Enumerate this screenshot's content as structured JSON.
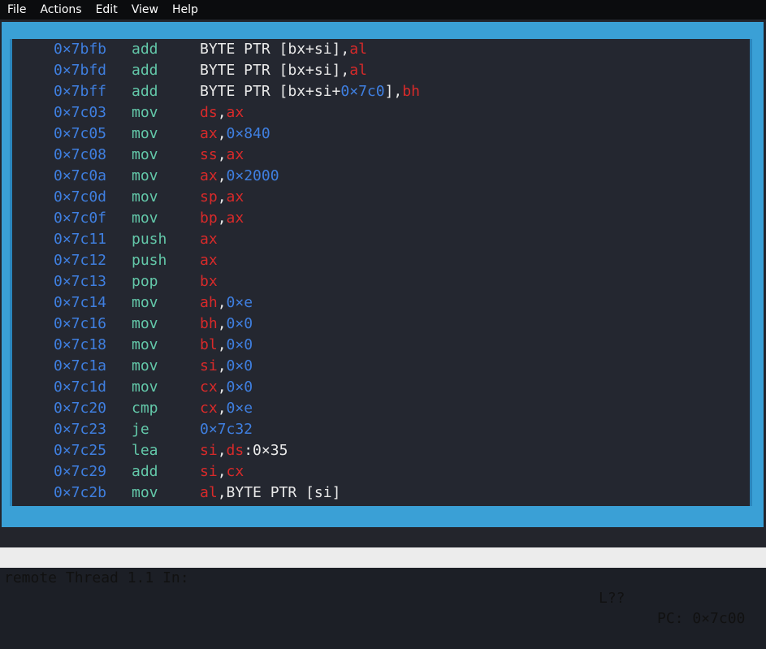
{
  "menu": [
    "File",
    "Actions",
    "Edit",
    "View",
    "Help"
  ],
  "colors": {
    "frame": "#3aa0d6",
    "address": "#3f7fe0",
    "mnemonic": "#63c8a9",
    "register": "#d82a2a",
    "text": "#e9e9e9",
    "status_bg": "#ececec"
  },
  "disassembly": [
    {
      "addr": "0×7bfb",
      "mnem": "add",
      "ops": [
        [
          "t",
          "BYTE PTR [bx+si],"
        ],
        [
          "r",
          "al"
        ]
      ]
    },
    {
      "addr": "0×7bfd",
      "mnem": "add",
      "ops": [
        [
          "t",
          "BYTE PTR [bx+si],"
        ],
        [
          "r",
          "al"
        ]
      ]
    },
    {
      "addr": "0×7bff",
      "mnem": "add",
      "ops": [
        [
          "t",
          "BYTE PTR [bx+si+"
        ],
        [
          "n",
          "0×7c0"
        ],
        [
          "t",
          "],"
        ],
        [
          "r",
          "bh"
        ]
      ]
    },
    {
      "addr": "0×7c03",
      "mnem": "mov",
      "ops": [
        [
          "r",
          "ds"
        ],
        [
          "t",
          ","
        ],
        [
          "r",
          "ax"
        ]
      ]
    },
    {
      "addr": "0×7c05",
      "mnem": "mov",
      "ops": [
        [
          "r",
          "ax"
        ],
        [
          "t",
          ","
        ],
        [
          "n",
          "0×840"
        ]
      ]
    },
    {
      "addr": "0×7c08",
      "mnem": "mov",
      "ops": [
        [
          "r",
          "ss"
        ],
        [
          "t",
          ","
        ],
        [
          "r",
          "ax"
        ]
      ]
    },
    {
      "addr": "0×7c0a",
      "mnem": "mov",
      "ops": [
        [
          "r",
          "ax"
        ],
        [
          "t",
          ","
        ],
        [
          "n",
          "0×2000"
        ]
      ]
    },
    {
      "addr": "0×7c0d",
      "mnem": "mov",
      "ops": [
        [
          "r",
          "sp"
        ],
        [
          "t",
          ","
        ],
        [
          "r",
          "ax"
        ]
      ]
    },
    {
      "addr": "0×7c0f",
      "mnem": "mov",
      "ops": [
        [
          "r",
          "bp"
        ],
        [
          "t",
          ","
        ],
        [
          "r",
          "ax"
        ]
      ]
    },
    {
      "addr": "0×7c11",
      "mnem": "push",
      "ops": [
        [
          "r",
          "ax"
        ]
      ]
    },
    {
      "addr": "0×7c12",
      "mnem": "push",
      "ops": [
        [
          "r",
          "ax"
        ]
      ]
    },
    {
      "addr": "0×7c13",
      "mnem": "pop",
      "ops": [
        [
          "r",
          "bx"
        ]
      ]
    },
    {
      "addr": "0×7c14",
      "mnem": "mov",
      "ops": [
        [
          "r",
          "ah"
        ],
        [
          "t",
          ","
        ],
        [
          "n",
          "0×e"
        ]
      ]
    },
    {
      "addr": "0×7c16",
      "mnem": "mov",
      "ops": [
        [
          "r",
          "bh"
        ],
        [
          "t",
          ","
        ],
        [
          "n",
          "0×0"
        ]
      ]
    },
    {
      "addr": "0×7c18",
      "mnem": "mov",
      "ops": [
        [
          "r",
          "bl"
        ],
        [
          "t",
          ","
        ],
        [
          "n",
          "0×0"
        ]
      ]
    },
    {
      "addr": "0×7c1a",
      "mnem": "mov",
      "ops": [
        [
          "r",
          "si"
        ],
        [
          "t",
          ","
        ],
        [
          "n",
          "0×0"
        ]
      ]
    },
    {
      "addr": "0×7c1d",
      "mnem": "mov",
      "ops": [
        [
          "r",
          "cx"
        ],
        [
          "t",
          ","
        ],
        [
          "n",
          "0×0"
        ]
      ]
    },
    {
      "addr": "0×7c20",
      "mnem": "cmp",
      "ops": [
        [
          "r",
          "cx"
        ],
        [
          "t",
          ","
        ],
        [
          "n",
          "0×e"
        ]
      ]
    },
    {
      "addr": "0×7c23",
      "mnem": "je",
      "ops": [
        [
          "n",
          "0×7c32"
        ]
      ]
    },
    {
      "addr": "0×7c25",
      "mnem": "lea",
      "ops": [
        [
          "r",
          "si"
        ],
        [
          "t",
          ","
        ],
        [
          "r",
          "ds"
        ],
        [
          "t",
          ":0×35"
        ]
      ]
    },
    {
      "addr": "0×7c29",
      "mnem": "add",
      "ops": [
        [
          "r",
          "si"
        ],
        [
          "t",
          ","
        ],
        [
          "r",
          "cx"
        ]
      ]
    },
    {
      "addr": "0×7c2b",
      "mnem": "mov",
      "ops": [
        [
          "r",
          "al"
        ],
        [
          "t",
          ",BYTE PTR [si]"
        ]
      ]
    }
  ],
  "status": {
    "left": "remote Thread 1.1 In:",
    "line": "L??",
    "pc": "PC: 0×7c00"
  }
}
